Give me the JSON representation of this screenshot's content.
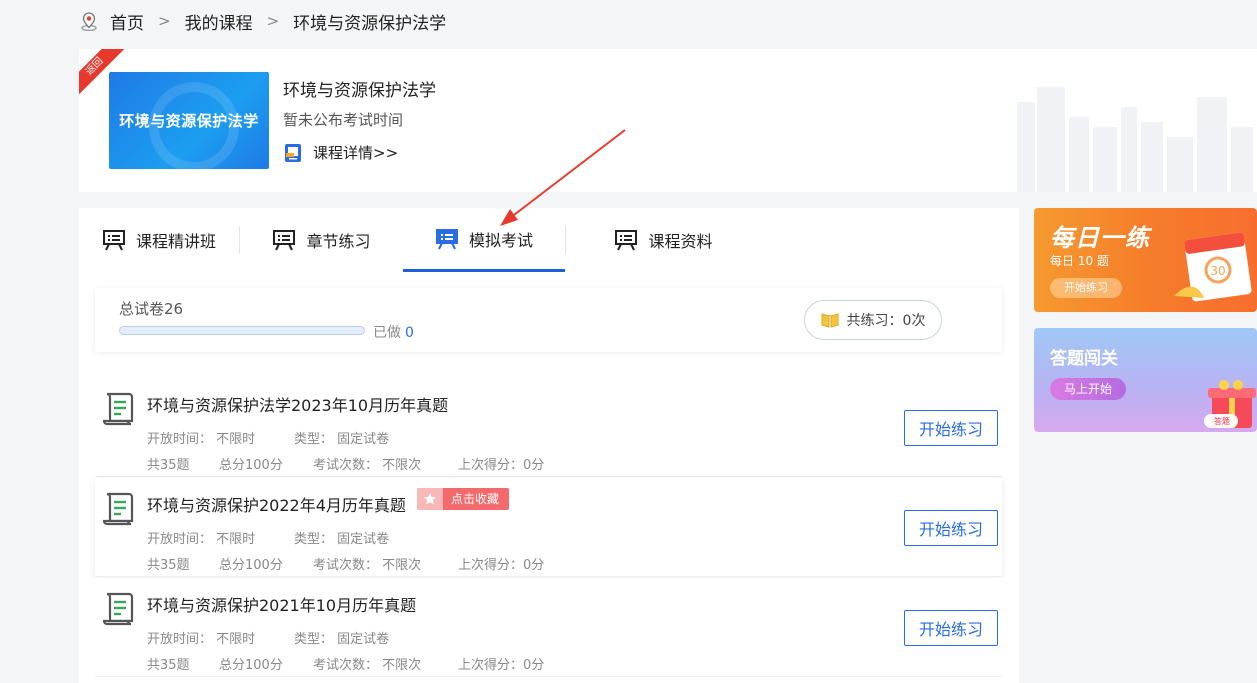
{
  "breadcrumb": {
    "home": "首页",
    "sep1": ">",
    "courses": "我的课程",
    "sep2": ">",
    "current": "环境与资源保护法学"
  },
  "course": {
    "ribbon": "返回",
    "thumb_text": "环境与资源保护法学",
    "title": "环境与资源保护法学",
    "exam_time": "暂未公布考试时间",
    "detail_link": "课程详情>>"
  },
  "tabs": [
    {
      "label": "课程精讲班",
      "active": false
    },
    {
      "label": "章节练习",
      "active": false
    },
    {
      "label": "模拟考试",
      "active": true
    },
    {
      "label": "课程资料",
      "active": false
    }
  ],
  "summary": {
    "total_label": "总试卷26",
    "done_label": "已做",
    "done_count": "0",
    "progress": 0,
    "practice_label": "共练习：0次"
  },
  "exams": [
    {
      "title": "环境与资源保护法学2023年10月历年真题",
      "open_time": "开放时间： 不限时",
      "type": "类型： 固定试卷",
      "questions": "共35题",
      "score": "总分100分",
      "attempts": "考试次数： 不限次",
      "last_score": "上次得分：0分",
      "start_label": "开始练习"
    },
    {
      "title": "环境与资源保护2022年4月历年真题",
      "favorite_label": "点击收藏",
      "open_time": "开放时间： 不限时",
      "type": "类型： 固定试卷",
      "questions": "共35题",
      "score": "总分100分",
      "attempts": "考试次数： 不限次",
      "last_score": "上次得分：0分",
      "start_label": "开始练习"
    },
    {
      "title": "环境与资源保护2021年10月历年真题",
      "open_time": "开放时间： 不限时",
      "type": "类型： 固定试卷",
      "questions": "共35题",
      "score": "总分100分",
      "attempts": "考试次数： 不限次",
      "last_score": "上次得分：0分",
      "start_label": "开始练习"
    }
  ],
  "promos": {
    "daily": {
      "heading": "每日一练",
      "sub": "每日 10 题",
      "button": "开始练习",
      "cal_text": "30"
    },
    "quiz": {
      "heading": "答题闯关",
      "button": "马上开始",
      "gift_text": "答题"
    }
  },
  "colors": {
    "accent": "#2a6de2",
    "tab_active": "#1a5fdc",
    "ribbon": "#e8392d",
    "favorite": "#f4696b",
    "daily_orange": "#f67b2b"
  },
  "icons": {
    "breadcrumb": "location-pin-icon",
    "tab": "presentation-board-icon",
    "exam": "scroll-paper-icon",
    "practice": "open-book-icon",
    "favorite": "star-icon"
  }
}
